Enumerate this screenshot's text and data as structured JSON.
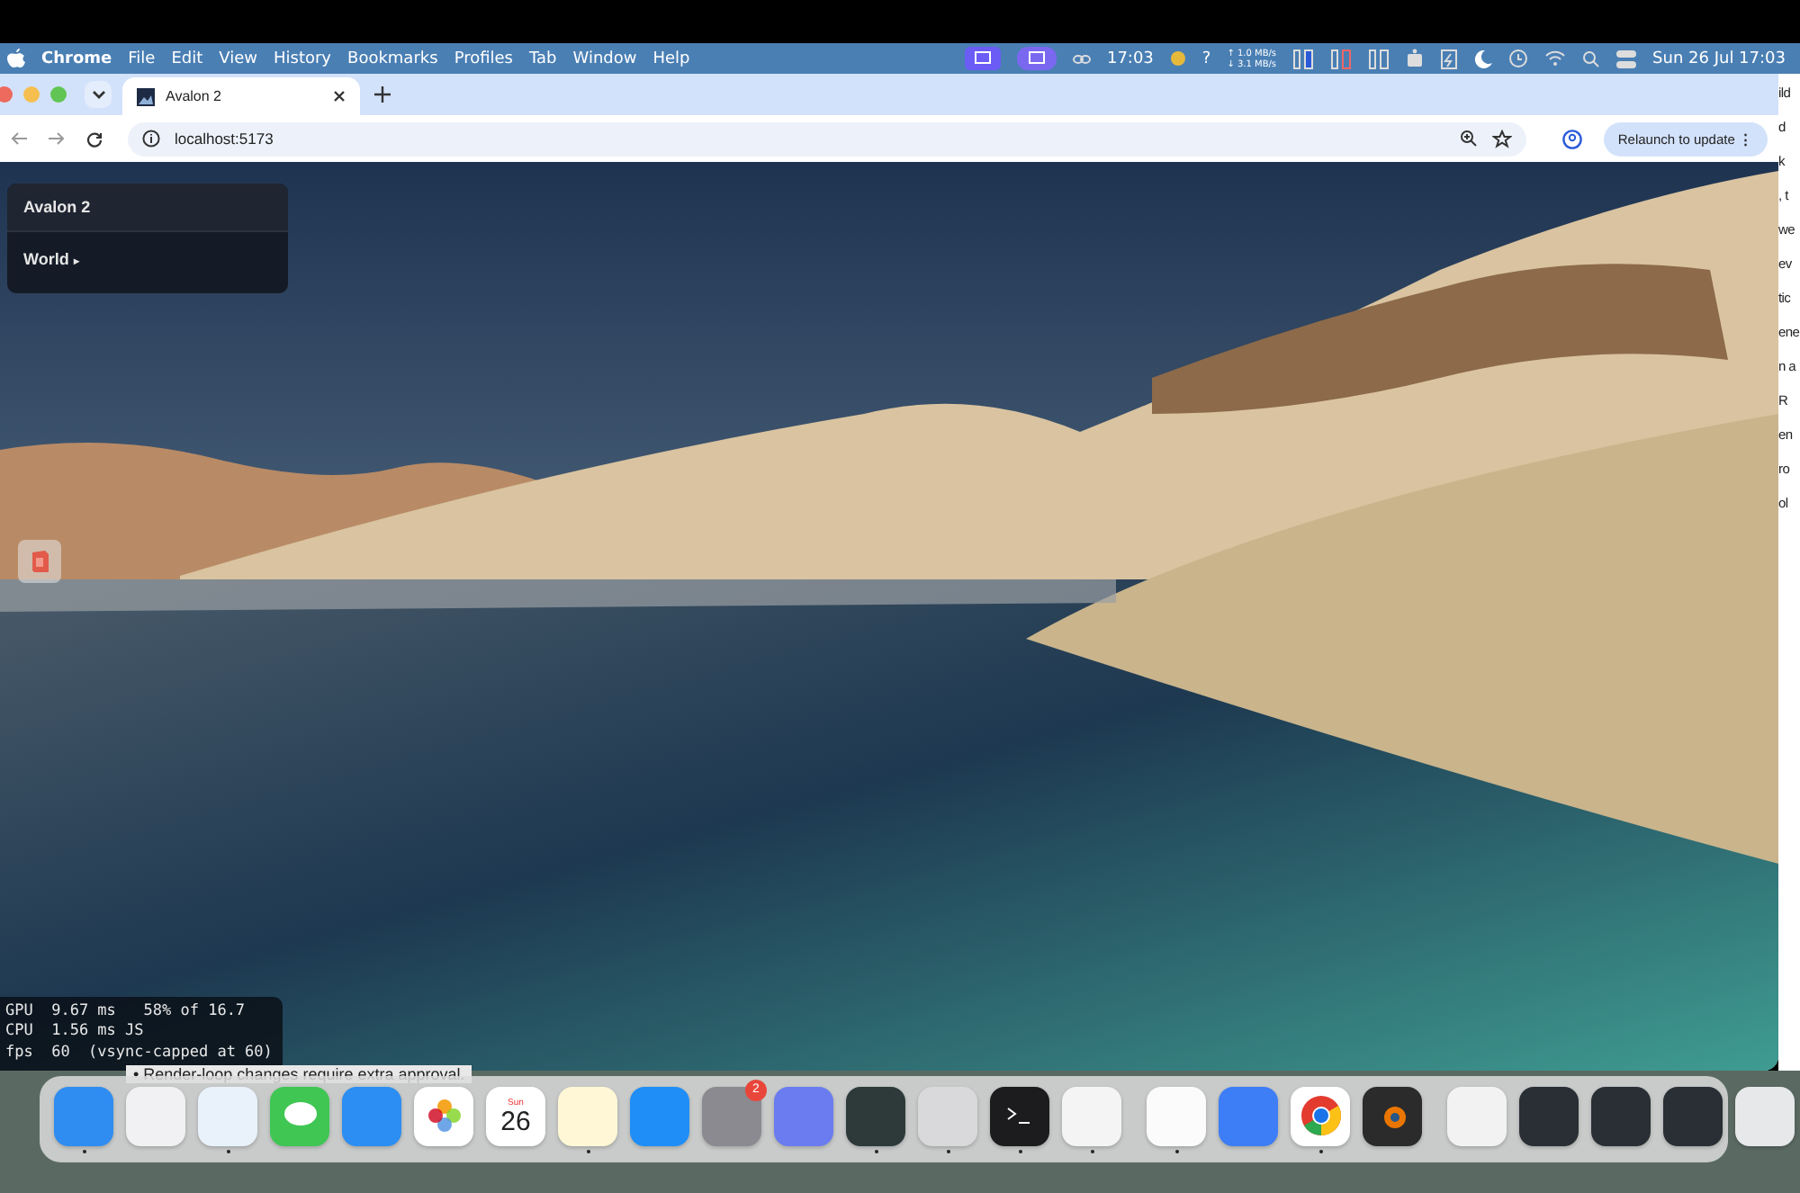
{
  "menu_bar": {
    "app": "Chrome",
    "items": [
      "File",
      "Edit",
      "View",
      "History",
      "Bookmarks",
      "Profiles",
      "Tab",
      "Window",
      "Help"
    ],
    "clock": "17:03",
    "help_glyph": "?",
    "upload_glyph": "↑",
    "upload": "1.0 MB/s",
    "download_glyph": "↓",
    "download": "3.1 MB/s",
    "date": "Sun 26 Jul  17:03"
  },
  "browser": {
    "tabs": [
      {
        "title": "Avalon 2",
        "selected": true
      }
    ],
    "address": "localhost:5173",
    "update_button": "Relaunch to update",
    "menu_glyph": "⋮"
  },
  "page": {
    "panel": {
      "title": "Avalon 2",
      "items": [
        {
          "label": "World",
          "glyph": "▸",
          "expanded": false
        }
      ]
    },
    "stats": [
      "GPU  9.67 ms   58% of 16.7",
      "CPU  1.56 ms JS",
      "fps  60  (vsync-capped at 60)"
    ]
  },
  "background_window": {
    "edge_fragments": [
      "ild",
      "d",
      "k",
      ", t",
      "we",
      "ev",
      "tic",
      "ene",
      "n a",
      "R",
      "en",
      "ro",
      "ol"
    ],
    "line": "• Render-loop changes require extra approval."
  },
  "dock": {
    "items": [
      {
        "kind": "finder",
        "running": true
      },
      {
        "kind": "launchpad",
        "running": false
      },
      {
        "kind": "safari",
        "running": true
      },
      {
        "kind": "messages",
        "running": false
      },
      {
        "kind": "mail",
        "running": false
      },
      {
        "kind": "photos",
        "running": false
      },
      {
        "kind": "calendar",
        "running": false,
        "day": "Sun",
        "date": "26"
      },
      {
        "kind": "notes",
        "running": true
      },
      {
        "kind": "appstore",
        "running": false
      },
      {
        "kind": "settings",
        "running": false,
        "badge": "2"
      },
      {
        "kind": "simulator",
        "running": false
      },
      {
        "kind": "gauge",
        "running": true
      },
      {
        "kind": "parallels",
        "running": true
      },
      {
        "kind": "terminal",
        "running": true
      },
      {
        "kind": "camera",
        "running": true
      },
      {
        "kind": "separator"
      },
      {
        "kind": "textedit",
        "running": true
      },
      {
        "kind": "preview",
        "running": false
      },
      {
        "kind": "chrome",
        "running": true
      },
      {
        "kind": "blender",
        "running": false
      },
      {
        "kind": "separator"
      },
      {
        "kind": "file",
        "running": false
      },
      {
        "kind": "window",
        "running": false
      },
      {
        "kind": "window",
        "running": false
      },
      {
        "kind": "window",
        "running": false
      },
      {
        "kind": "trash",
        "running": false
      }
    ]
  }
}
